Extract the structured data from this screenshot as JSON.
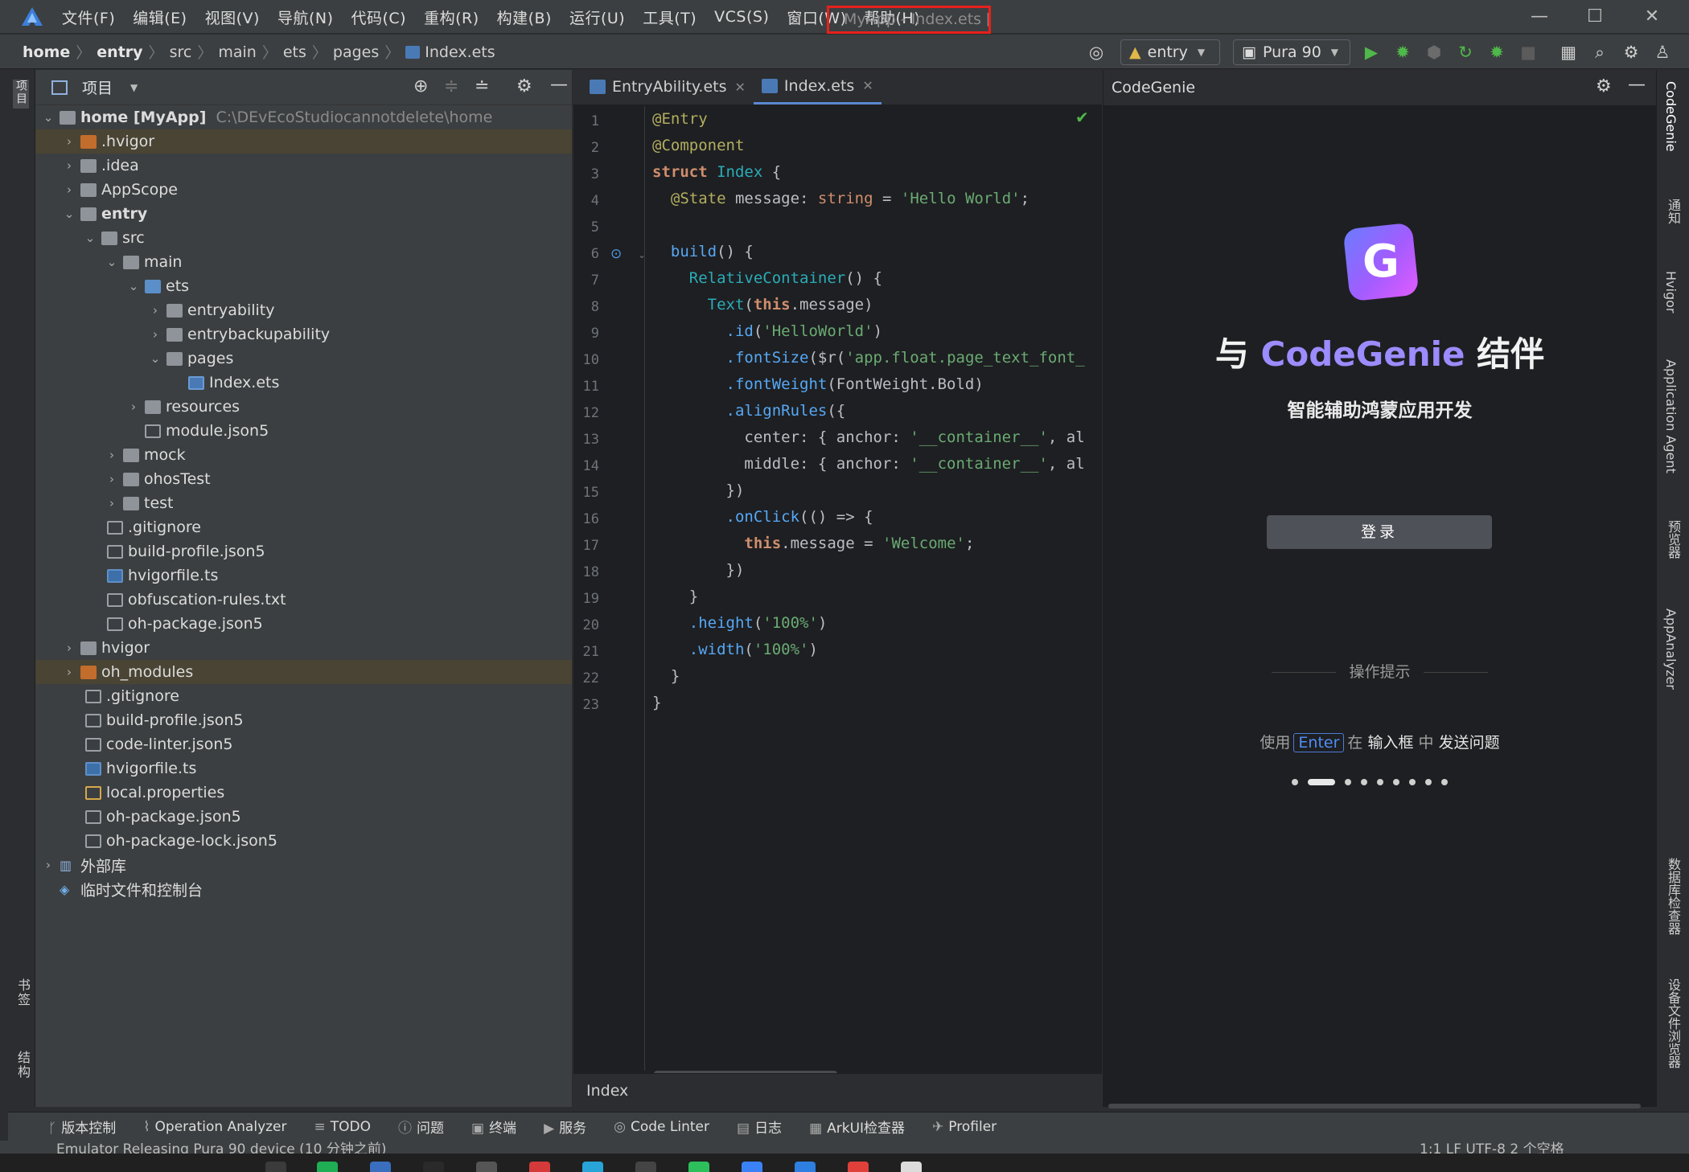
{
  "menubar": {
    "items": [
      "文件(F)",
      "编辑(E)",
      "视图(V)",
      "导航(N)",
      "代码(C)",
      "重构(R)",
      "构建(B)",
      "运行(U)",
      "工具(T)",
      "VCS(S)",
      "窗口(W)",
      "帮助(H)"
    ],
    "title": "MyApp - Index.ets [entry]"
  },
  "navbar": {
    "crumbs": [
      "home",
      "entry",
      "src",
      "main",
      "ets",
      "pages",
      "Index.ets"
    ],
    "module": "entry",
    "device": "Pura 90"
  },
  "leftstrip": {
    "project": "项目",
    "bookmarks": "书签",
    "structure": "结构"
  },
  "project": {
    "header": "项目",
    "rows": [
      {
        "name": "home [MyApp]",
        "path": "C:\\DEvEcoStudiocannotdelete\\home"
      },
      {
        "name": ".hvigor"
      },
      {
        "name": ".idea"
      },
      {
        "name": "AppScope"
      },
      {
        "name": "entry"
      },
      {
        "name": "src"
      },
      {
        "name": "main"
      },
      {
        "name": "ets"
      },
      {
        "name": "entryability"
      },
      {
        "name": "entrybackupability"
      },
      {
        "name": "pages"
      },
      {
        "name": "Index.ets"
      },
      {
        "name": "resources"
      },
      {
        "name": "module.json5"
      },
      {
        "name": "mock"
      },
      {
        "name": "ohosTest"
      },
      {
        "name": "test"
      },
      {
        "name": ".gitignore"
      },
      {
        "name": "build-profile.json5"
      },
      {
        "name": "hvigorfile.ts"
      },
      {
        "name": "obfuscation-rules.txt"
      },
      {
        "name": "oh-package.json5"
      },
      {
        "name": "hvigor"
      },
      {
        "name": "oh_modules"
      },
      {
        "name": ".gitignore"
      },
      {
        "name": "build-profile.json5"
      },
      {
        "name": "code-linter.json5"
      },
      {
        "name": "hvigorfile.ts"
      },
      {
        "name": "local.properties"
      },
      {
        "name": "oh-package.json5"
      },
      {
        "name": "oh-package-lock.json5"
      },
      {
        "name": "外部库"
      },
      {
        "name": "临时文件和控制台"
      }
    ]
  },
  "editor": {
    "tabs": [
      "EntryAbility.ets",
      "Index.ets"
    ],
    "line_numbers": [
      "1",
      "2",
      "3",
      "4",
      "5",
      "6",
      "7",
      "8",
      "9",
      "10",
      "11",
      "12",
      "13",
      "14",
      "15",
      "16",
      "17",
      "18",
      "19",
      "20",
      "21",
      "22",
      "23"
    ],
    "code": {
      "l1a": "@Entry",
      "l2a": "@Component",
      "l3a": "struct",
      "l3b": " Index ",
      "l3c": "{",
      "l4a": "  @State",
      "l4b": " message: ",
      "l4c": "string",
      "l4d": " = ",
      "l4e": "'Hello World'",
      "l4f": ";",
      "l6a": "  build",
      "l6b": "() {",
      "l7a": "    RelativeContainer",
      "l7b": "() {",
      "l8a": "      Text",
      "l8b": "(",
      "l8c": "this",
      "l8d": ".message)",
      "l9a": "        .id",
      "l9b": "(",
      "l9c": "'HelloWorld'",
      "l9d": ")",
      "l10a": "        .fontSize",
      "l10b": "($r(",
      "l10c": "'app.float.page_text_font_",
      "l11a": "        .fontWeight",
      "l11b": "(FontWeight.Bold)",
      "l12a": "        .alignRules",
      "l12b": "({",
      "l13a": "          center: { anchor: ",
      "l13b": "'__container__'",
      "l13c": ", al",
      "l14a": "          middle: { anchor: ",
      "l14b": "'__container__'",
      "l14c": ", al",
      "l15a": "        })",
      "l16a": "        .onClick",
      "l16b": "(() => {",
      "l17a": "          this",
      "l17b": ".message = ",
      "l17c": "'Welcome'",
      "l17d": ";",
      "l18a": "        })",
      "l19a": "    }",
      "l20a": "    .height",
      "l20b": "(",
      "l20c": "'100%'",
      "l20d": ")",
      "l21a": "    .width",
      "l21b": "(",
      "l21c": "'100%'",
      "l21d": ")",
      "l22a": "  }",
      "l23a": "}"
    },
    "footer": "Index"
  },
  "genie": {
    "header": "CodeGenie",
    "logo_letter": "G",
    "title_pre": "与 ",
    "title_accent": "CodeGenie",
    "title_post": " 结伴",
    "subtitle": "智能辅助鸿蒙应用开发",
    "login": "登录",
    "hint": "操作提示",
    "tip_pre": "使用",
    "tip_key": "Enter",
    "tip_mid": "在",
    "tip_b1": "输入框",
    "tip_mid2": "中",
    "tip_b2": "发送问题"
  },
  "rightstrip": [
    "CodeGenie",
    "通知",
    "Hvigor",
    "Application Agent",
    "预览器",
    "AppAnalyzer",
    "数据库检查器",
    "设备文件浏览器"
  ],
  "bottombar": [
    "版本控制",
    "Operation Analyzer",
    "TODO",
    "问题",
    "终端",
    "服务",
    "Code Linter",
    "日志",
    "ArkUI检查器",
    "Profiler"
  ],
  "statusbar": {
    "left": "Emulator Releasing Pura 90 device  (10 分钟之前)",
    "right": "1:1   LF   UTF-8   2 个空格"
  },
  "colors": {
    "accent": "#9b8cff",
    "title_box": "#e8201c",
    "run": "#4fb84a"
  }
}
